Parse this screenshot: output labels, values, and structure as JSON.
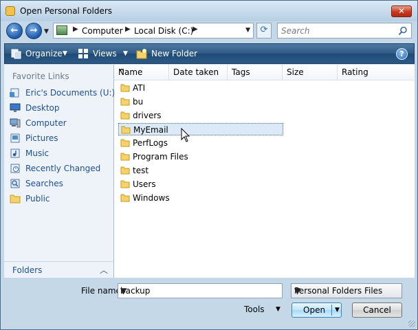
{
  "window": {
    "title": "Open Personal Folders",
    "close_label": "✕"
  },
  "nav": {
    "breadcrumbs": [
      "Computer",
      "Local Disk (C:)"
    ],
    "search_placeholder": "Search"
  },
  "toolbar": {
    "organize": "Organize",
    "views": "Views",
    "new_folder": "New Folder",
    "help": "?"
  },
  "sidebar": {
    "heading": "Favorite Links",
    "items": [
      {
        "label": "Eric's Documents (U:)",
        "icon": "documents-icon"
      },
      {
        "label": "Desktop",
        "icon": "desktop-icon"
      },
      {
        "label": "Computer",
        "icon": "computer-icon"
      },
      {
        "label": "Pictures",
        "icon": "pictures-icon"
      },
      {
        "label": "Music",
        "icon": "music-icon"
      },
      {
        "label": "Recently Changed",
        "icon": "recent-icon"
      },
      {
        "label": "Searches",
        "icon": "searches-icon"
      },
      {
        "label": "Public",
        "icon": "public-icon"
      }
    ],
    "folders_label": "Folders"
  },
  "file_list": {
    "columns": [
      "Name",
      "Date taken",
      "Tags",
      "Size",
      "Rating"
    ],
    "items": [
      "ATI",
      "bu",
      "drivers",
      "MyEmail",
      "PerfLogs",
      "Program Files",
      "test",
      "Users",
      "Windows"
    ],
    "selected": "MyEmail"
  },
  "bottom": {
    "file_name_label": "File name:",
    "file_name_value": "backup",
    "file_type": "Personal Folders Files",
    "tools_label": "Tools",
    "open_label": "Open",
    "cancel_label": "Cancel"
  },
  "colors": {
    "accent": "#2f5a86",
    "link": "#1c4f98",
    "selection": "#dce9f8"
  }
}
